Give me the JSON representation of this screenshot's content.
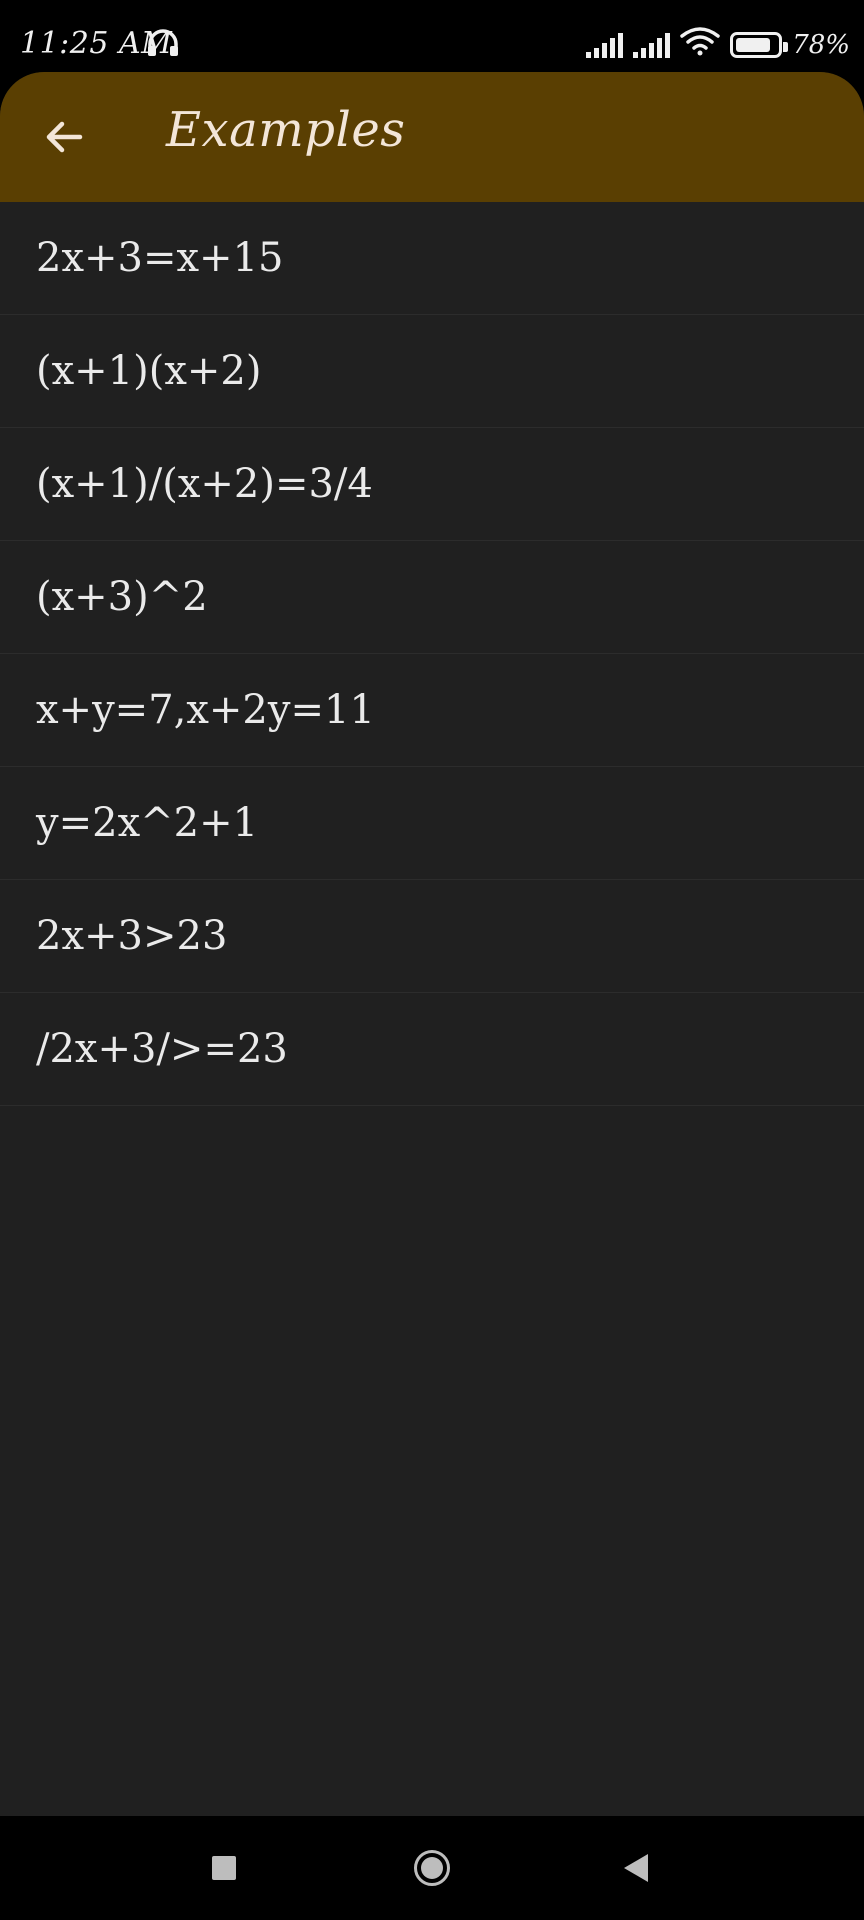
{
  "status_bar": {
    "time": "11:25 AM",
    "battery_percent": "78%",
    "battery_level": 0.78,
    "icons": [
      "headset-icon",
      "signal-icon",
      "signal-icon",
      "wifi-icon",
      "battery-icon"
    ]
  },
  "app_bar": {
    "title": "Examples",
    "back_icon": "arrow-left-icon",
    "color": "#5a3f02"
  },
  "examples": [
    "2x+3=x+15",
    "(x+1)(x+2)",
    "(x+1)/(x+2)=3/4",
    "(x+3)^2",
    "x+y=7,x+2y=11",
    "y=2x^2+1",
    "2x+3>23",
    "/2x+3/>=23"
  ],
  "nav_bar": {
    "icons": [
      "recents-square-icon",
      "home-circle-icon",
      "back-triangle-icon"
    ]
  }
}
